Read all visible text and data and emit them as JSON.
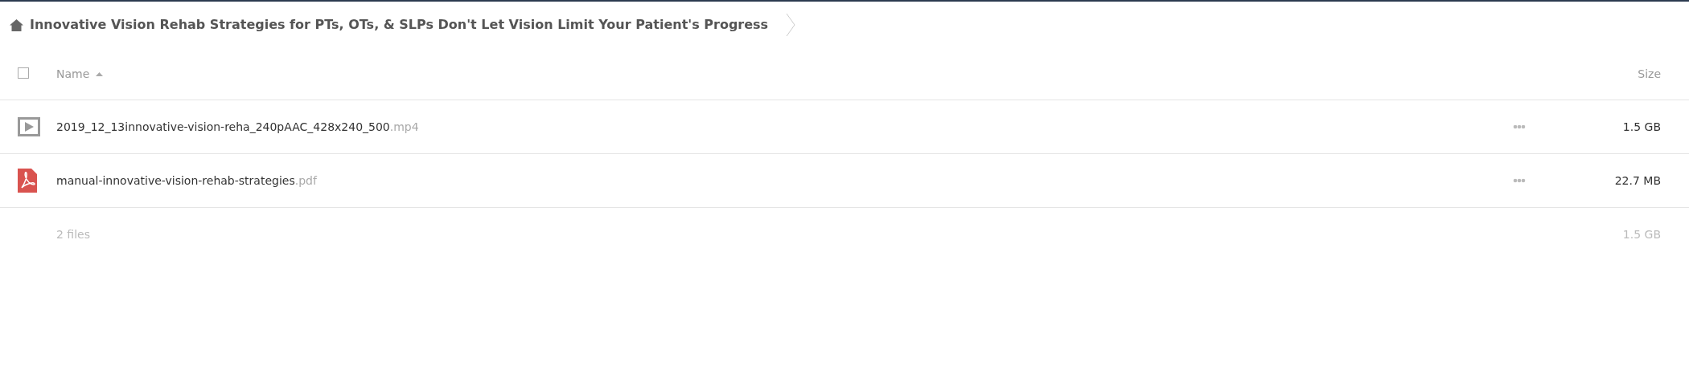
{
  "breadcrumb": {
    "title": "Innovative Vision Rehab Strategies for PTs, OTs, & SLPs Don't Let Vision Limit Your Patient's Progress"
  },
  "table": {
    "select_all": {
      "checked": false
    },
    "columns": [
      {
        "label": "Name",
        "sorted": true
      },
      {
        "label": "Size",
        "sorted": false
      }
    ],
    "rows": [
      {
        "kind": "video",
        "name": "2019_12_13innovative-vision-reha_240pAAC_428x240_500",
        "extension": ".mp4",
        "size": "1.5 GB"
      },
      {
        "kind": "pdf",
        "name": "manual-innovative-vision-rehab-strategies",
        "extension": ".pdf",
        "size": "22.7 MB"
      }
    ]
  },
  "footer": {
    "count": "2 files",
    "total": "1.5 GB"
  }
}
